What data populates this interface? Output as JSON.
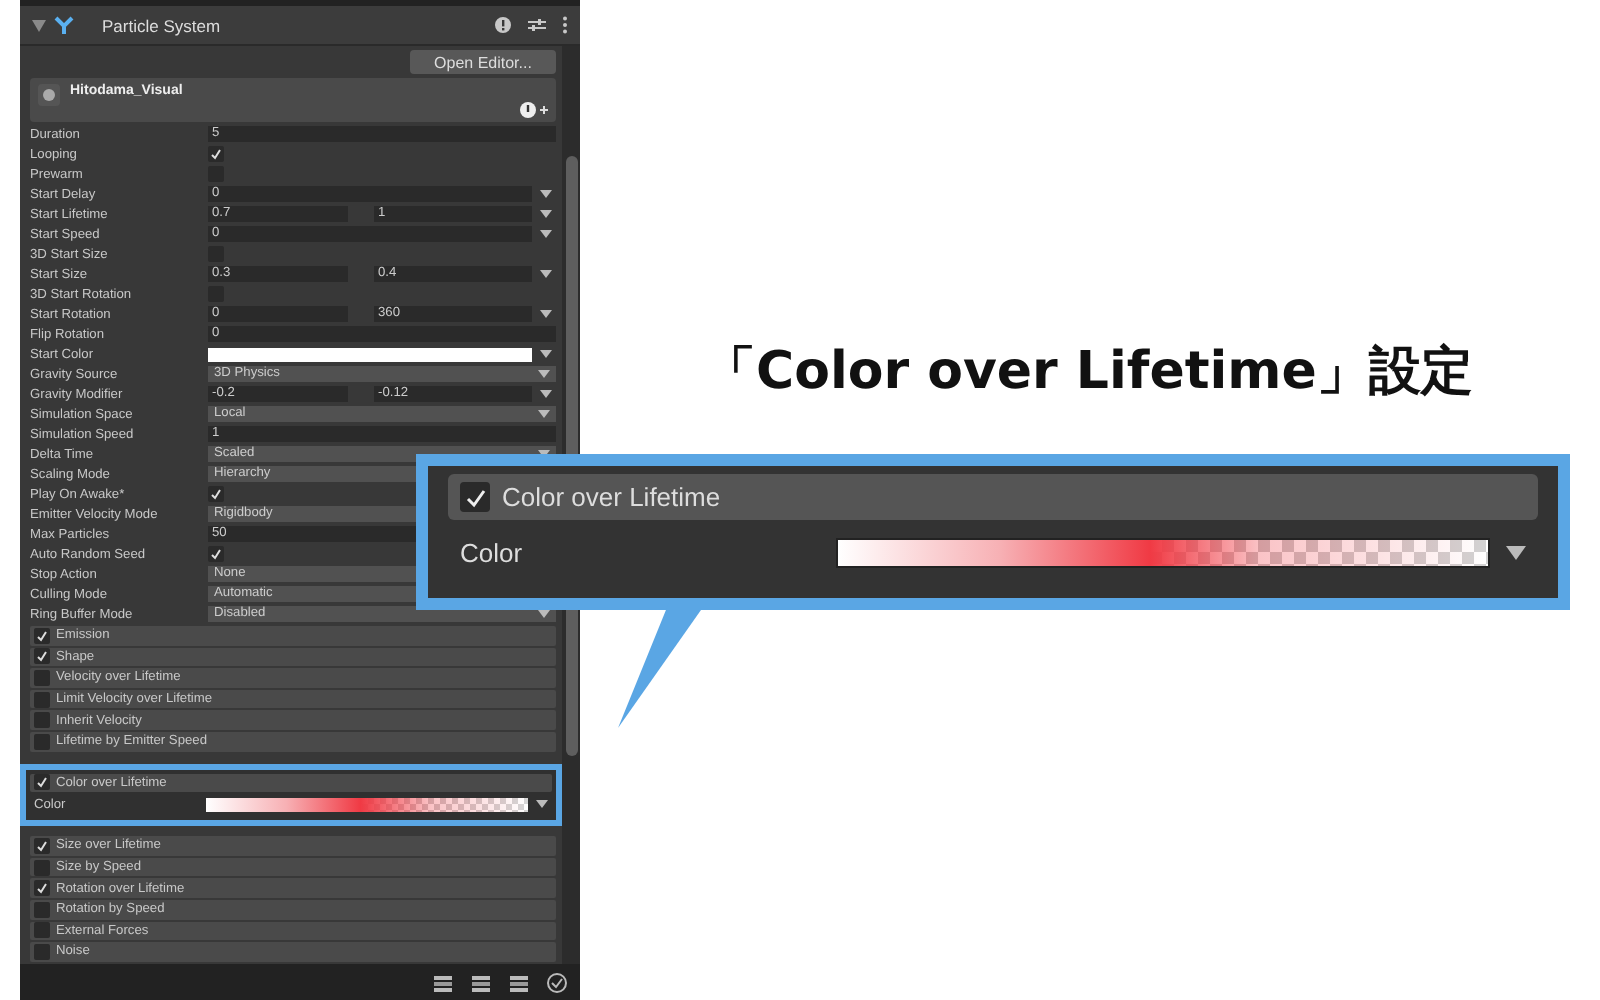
{
  "component": {
    "title": "Particle System",
    "open_editor": "Open Editor..."
  },
  "asset": {
    "name": "Hitodama_Visual"
  },
  "properties": [
    {
      "label": "Duration",
      "kind": "field",
      "value": "5"
    },
    {
      "label": "Looping",
      "kind": "check",
      "checked": true
    },
    {
      "label": "Prewarm",
      "kind": "check",
      "checked": false
    },
    {
      "label": "Start Delay",
      "kind": "curve",
      "value": "0"
    },
    {
      "label": "Start Lifetime",
      "kind": "two",
      "value": "0.7",
      "value2": "1"
    },
    {
      "label": "Start Speed",
      "kind": "curve",
      "value": "0"
    },
    {
      "label": "3D Start Size",
      "kind": "check",
      "checked": false
    },
    {
      "label": "Start Size",
      "kind": "two",
      "value": "0.3",
      "value2": "0.4"
    },
    {
      "label": "3D Start Rotation",
      "kind": "check",
      "checked": false
    },
    {
      "label": "Start Rotation",
      "kind": "two",
      "value": "0",
      "value2": "360"
    },
    {
      "label": "Flip Rotation",
      "kind": "field",
      "value": "0"
    },
    {
      "label": "Start Color",
      "kind": "color"
    },
    {
      "label": "Gravity Source",
      "kind": "dropdown",
      "value": "3D Physics"
    },
    {
      "label": "Gravity Modifier",
      "kind": "two",
      "value": "-0.2",
      "value2": "-0.12"
    },
    {
      "label": "Simulation Space",
      "kind": "dropdown",
      "value": "Local"
    },
    {
      "label": "Simulation Speed",
      "kind": "field",
      "value": "1"
    },
    {
      "label": "Delta Time",
      "kind": "dropdown",
      "value": "Scaled"
    },
    {
      "label": "Scaling Mode",
      "kind": "dropdown",
      "value": "Hierarchy"
    },
    {
      "label": "Play On Awake*",
      "kind": "check",
      "checked": true
    },
    {
      "label": "Emitter Velocity Mode",
      "kind": "dropdown",
      "value": "Rigidbody"
    },
    {
      "label": "Max Particles",
      "kind": "field",
      "value": "50"
    },
    {
      "label": "Auto Random Seed",
      "kind": "check",
      "checked": true
    },
    {
      "label": "Stop Action",
      "kind": "dropdown",
      "value": "None"
    },
    {
      "label": "Culling Mode",
      "kind": "dropdown",
      "value": "Automatic"
    },
    {
      "label": "Ring Buffer Mode",
      "kind": "dropdown",
      "value": "Disabled"
    }
  ],
  "modules": [
    {
      "label": "Emission",
      "checked": true,
      "kind": "module"
    },
    {
      "label": "Shape",
      "checked": true,
      "kind": "module"
    },
    {
      "label": "Velocity over Lifetime",
      "checked": false,
      "kind": "module"
    },
    {
      "label": "Limit Velocity over Lifetime",
      "checked": false,
      "kind": "module"
    },
    {
      "label": "Inherit Velocity",
      "checked": false,
      "kind": "module"
    },
    {
      "label": "Lifetime by Emitter Speed",
      "checked": false,
      "kind": "module"
    },
    {
      "label": "Color over Lifetime",
      "checked": true,
      "kind": "highlighted",
      "property": "Color"
    },
    {
      "label": "Size over Lifetime",
      "checked": true,
      "kind": "module"
    },
    {
      "label": "Size by Speed",
      "checked": false,
      "kind": "module"
    },
    {
      "label": "Rotation over Lifetime",
      "checked": true,
      "kind": "module"
    },
    {
      "label": "Rotation by Speed",
      "checked": false,
      "kind": "module"
    },
    {
      "label": "External Forces",
      "checked": false,
      "kind": "module"
    },
    {
      "label": "Noise",
      "checked": false,
      "kind": "module"
    }
  ],
  "callout": {
    "heading": "「Color over Lifetime」設定",
    "module": {
      "label": "Color over Lifetime",
      "checked": true
    },
    "property": "Color"
  }
}
